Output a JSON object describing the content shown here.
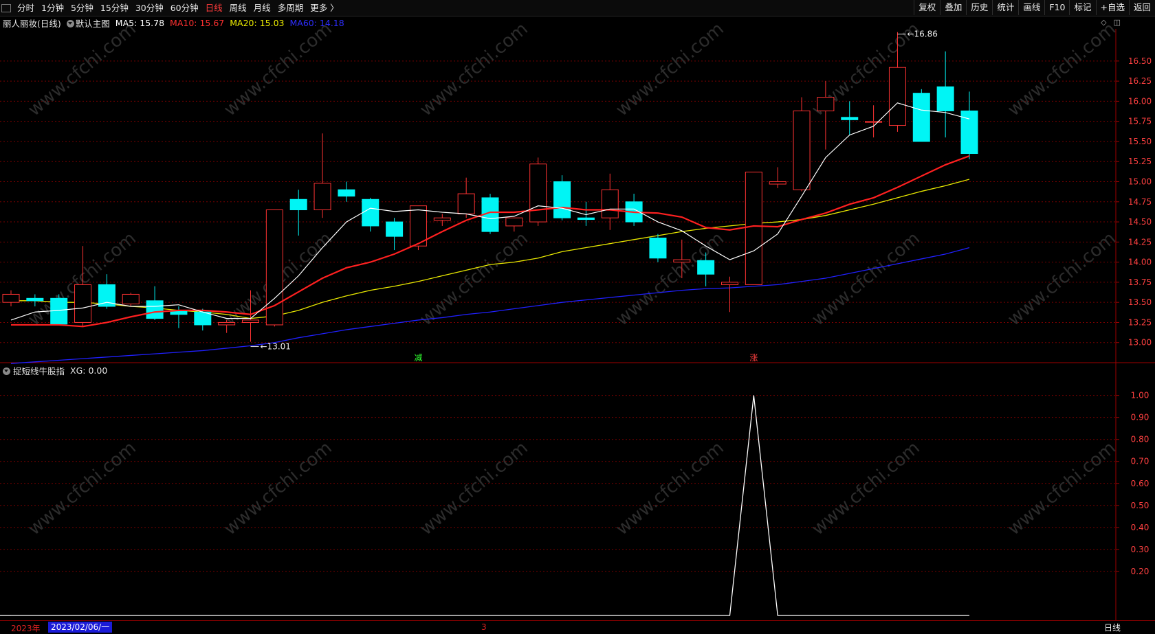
{
  "toolbar": {
    "left": [
      "分时",
      "1分钟",
      "5分钟",
      "15分钟",
      "30分钟",
      "60分钟",
      "日线",
      "周线",
      "月线",
      "多周期",
      "更多 〉"
    ],
    "active": "日线",
    "right": [
      "复权",
      "叠加",
      "历史",
      "统计",
      "画线",
      "F10",
      "标记",
      "+自选",
      "返回"
    ]
  },
  "info": {
    "stock": "丽人丽妆(日线)",
    "template": "默认主图",
    "ma5": "MA5: 15.78",
    "ma10": "MA10: 15.67",
    "ma20": "MA20: 15.03",
    "ma60": "MA60: 14.18"
  },
  "sub_info": {
    "name": "捉短线牛股指",
    "xg": "XG: 0.00"
  },
  "bottom": {
    "year": "2023年",
    "date": "2023/02/06/一",
    "marker": "3",
    "period": "日线"
  },
  "colors": {
    "up": "#ff3333",
    "down": "#00f5f5",
    "ma5": "#ffffff",
    "ma10": "#ff2020",
    "ma20": "#e8e800",
    "ma60": "#2020ff",
    "grid": "#7a0000"
  },
  "watermark": "www.cfchi.com",
  "chart_data": [
    {
      "type": "candlestick",
      "title": "丽人丽妆(日线)",
      "ylim": [
        12.75,
        16.9
      ],
      "yticks": [
        13.0,
        13.25,
        13.5,
        13.75,
        14.0,
        14.25,
        14.5,
        14.75,
        15.0,
        15.25,
        15.5,
        15.75,
        16.0,
        16.25,
        16.5
      ],
      "ohlc": [
        [
          13.5,
          13.65,
          13.45,
          13.6
        ],
        [
          13.55,
          13.6,
          13.45,
          13.52
        ],
        [
          13.55,
          13.6,
          13.22,
          13.23
        ],
        [
          13.25,
          14.2,
          13.2,
          13.72
        ],
        [
          13.72,
          13.85,
          13.42,
          13.45
        ],
        [
          13.48,
          13.62,
          13.45,
          13.6
        ],
        [
          13.52,
          13.7,
          13.28,
          13.3
        ],
        [
          13.4,
          13.45,
          13.18,
          13.35
        ],
        [
          13.38,
          13.42,
          13.15,
          13.22
        ],
        [
          13.22,
          13.28,
          13.12,
          13.25
        ],
        [
          13.25,
          13.65,
          13.01,
          13.28
        ],
        [
          13.22,
          14.65,
          13.2,
          14.65
        ],
        [
          14.78,
          14.9,
          14.33,
          14.65
        ],
        [
          14.65,
          15.6,
          14.55,
          14.98
        ],
        [
          14.9,
          15.0,
          14.75,
          14.82
        ],
        [
          14.78,
          14.8,
          14.38,
          14.45
        ],
        [
          14.5,
          14.55,
          14.15,
          14.32
        ],
        [
          14.2,
          14.7,
          14.15,
          14.7
        ],
        [
          14.52,
          14.6,
          14.45,
          14.55
        ],
        [
          14.6,
          15.05,
          14.55,
          14.85
        ],
        [
          14.8,
          14.85,
          14.35,
          14.38
        ],
        [
          14.45,
          14.55,
          14.38,
          14.55
        ],
        [
          14.5,
          15.3,
          14.45,
          15.22
        ],
        [
          15.0,
          15.08,
          14.52,
          14.55
        ],
        [
          14.55,
          14.75,
          14.45,
          14.53
        ],
        [
          14.55,
          15.1,
          14.4,
          14.9
        ],
        [
          14.75,
          14.85,
          14.45,
          14.5
        ],
        [
          14.3,
          14.35,
          14.0,
          14.05
        ],
        [
          14.0,
          14.28,
          13.8,
          14.03
        ],
        [
          14.02,
          14.12,
          13.7,
          13.85
        ],
        [
          13.72,
          13.82,
          13.38,
          13.75
        ],
        [
          13.72,
          15.1,
          13.72,
          15.12
        ],
        [
          14.97,
          15.18,
          14.92,
          15.0
        ],
        [
          14.9,
          16.05,
          14.88,
          15.88
        ],
        [
          15.88,
          16.25,
          15.4,
          16.05
        ],
        [
          15.8,
          16.0,
          15.58,
          15.77
        ],
        [
          15.75,
          15.95,
          15.55,
          15.75
        ],
        [
          15.7,
          16.86,
          15.62,
          16.42
        ],
        [
          16.1,
          16.15,
          15.5,
          15.5
        ],
        [
          16.18,
          16.62,
          15.55,
          15.88
        ],
        [
          15.88,
          16.12,
          15.28,
          15.35
        ]
      ],
      "ma5": [
        13.28,
        13.38,
        13.4,
        13.43,
        13.5,
        13.45,
        13.45,
        13.47,
        13.38,
        13.3,
        13.3,
        13.55,
        13.83,
        14.18,
        14.5,
        14.67,
        14.63,
        14.65,
        14.62,
        14.6,
        14.54,
        14.57,
        14.7,
        14.67,
        14.59,
        14.66,
        14.66,
        14.5,
        14.39,
        14.2,
        14.03,
        14.14,
        14.35,
        14.82,
        15.3,
        15.58,
        15.69,
        15.98,
        15.89,
        15.86,
        15.78
      ],
      "ma10": [
        13.22,
        13.22,
        13.22,
        13.2,
        13.25,
        13.32,
        13.38,
        13.4,
        13.4,
        13.38,
        13.35,
        13.46,
        13.63,
        13.8,
        13.93,
        14.0,
        14.1,
        14.23,
        14.38,
        14.52,
        14.62,
        14.62,
        14.65,
        14.68,
        14.65,
        14.65,
        14.62,
        14.61,
        14.56,
        14.43,
        14.4,
        14.45,
        14.44,
        14.53,
        14.61,
        14.72,
        14.8,
        14.93,
        15.07,
        15.21,
        15.32,
        15.67
      ],
      "ma20": [
        13.52,
        13.52,
        13.5,
        13.5,
        13.48,
        13.45,
        13.43,
        13.4,
        13.38,
        13.35,
        13.3,
        13.33,
        13.4,
        13.5,
        13.58,
        13.65,
        13.7,
        13.76,
        13.83,
        13.9,
        13.97,
        14.0,
        14.05,
        14.13,
        14.18,
        14.23,
        14.28,
        14.33,
        14.38,
        14.42,
        14.45,
        14.48,
        14.5,
        14.53,
        14.58,
        14.65,
        14.72,
        14.8,
        14.88,
        14.95,
        15.03
      ],
      "ma60": [
        12.74,
        12.76,
        12.78,
        12.8,
        12.82,
        12.84,
        12.86,
        12.88,
        12.9,
        12.93,
        12.96,
        13.0,
        13.06,
        13.11,
        13.16,
        13.2,
        13.24,
        13.28,
        13.31,
        13.35,
        13.38,
        13.42,
        13.46,
        13.5,
        13.53,
        13.56,
        13.59,
        13.62,
        13.65,
        13.67,
        13.68,
        13.7,
        13.72,
        13.76,
        13.8,
        13.86,
        13.92,
        13.98,
        14.04,
        14.1,
        14.18
      ],
      "annotations": [
        {
          "bar": 10,
          "label": "13.01"
        },
        {
          "bar": 37,
          "label": "16.86"
        }
      ],
      "signals": [
        {
          "bar": 17,
          "label": "减"
        },
        {
          "bar": 31,
          "label": "涨"
        }
      ]
    },
    {
      "type": "line",
      "title": "捉短线牛股指",
      "ylim": [
        0,
        1.08
      ],
      "yticks": [
        0.2,
        0.3,
        0.4,
        0.5,
        0.6,
        0.7,
        0.8,
        0.9,
        1.0
      ],
      "values": [
        0,
        0,
        0,
        0,
        0,
        0,
        0,
        0,
        0,
        0,
        0,
        0,
        0,
        0,
        0,
        0,
        0,
        0,
        0,
        0,
        0,
        0,
        0,
        0,
        0,
        0,
        0,
        0,
        0,
        0,
        0,
        1,
        0,
        0,
        0,
        0,
        0,
        0,
        0,
        0,
        0
      ]
    }
  ]
}
